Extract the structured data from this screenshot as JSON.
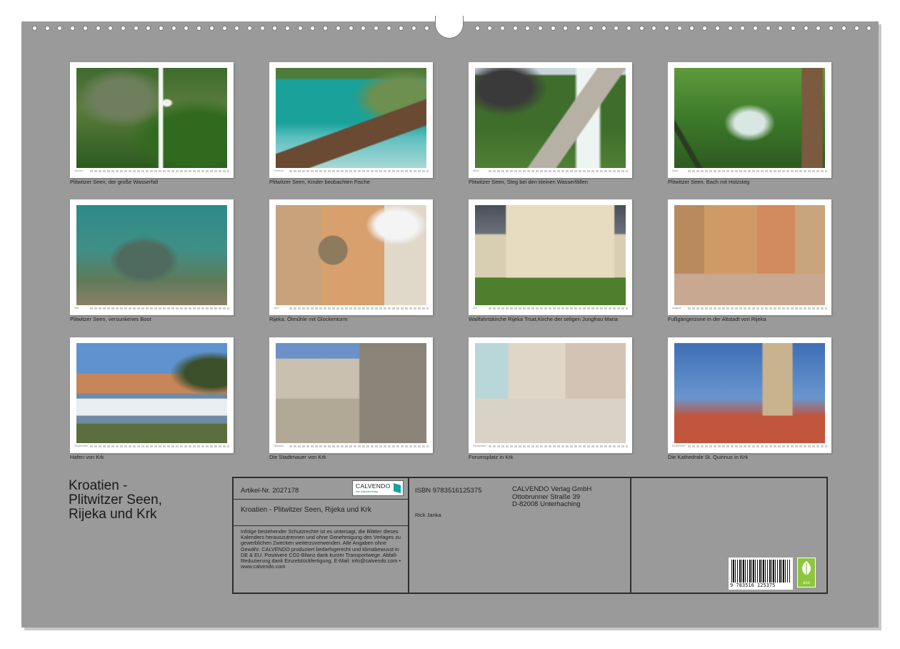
{
  "calendar_title": "Kroatien -\nPlitwitzer Seen,\nRijeka und Krk",
  "months": [
    {
      "name": "Januar",
      "caption": "Plitwitzer Seen, der große Wasserfall"
    },
    {
      "name": "Februar",
      "caption": "Plitwitzer Seen, Kinder beobachten Fische"
    },
    {
      "name": "März",
      "caption": "Plitwitzer Seen, Steg bei den kleinen Wasserfällen"
    },
    {
      "name": "April",
      "caption": "Plitwitzer Seen, Bach mit Holzsteg"
    },
    {
      "name": "Mai",
      "caption": "Plitwitzer Seen, versunkenes Boot"
    },
    {
      "name": "Juni",
      "caption": "Rijeka, Ölmühle mit Glockenturm"
    },
    {
      "name": "Juli",
      "caption": "Wallfahrtskirche Rijeka Trsat,Kirche der seligen Jungfrau Maria"
    },
    {
      "name": "August",
      "caption": "Fußgängerzone in der Altstadt von Rijeka"
    },
    {
      "name": "September",
      "caption": "Hafen von Krk"
    },
    {
      "name": "Oktober",
      "caption": "Die Stadtmauer von Krk"
    },
    {
      "name": "November",
      "caption": "Forumsplatz in Krk"
    },
    {
      "name": "Dezember",
      "caption": "Die Kathedrale St. Quirinus in Krk"
    }
  ],
  "info": {
    "article": "Artikel-Nr. 2027178",
    "logo_main": "CALVENDO",
    "logo_sub": "Ihre Kalenderverlag",
    "product_title": "Kroatien - Plitwitzer Seen, Rijeka und Krk",
    "legal": "Infolge bestehender Schutzrechte ist es untersagt, die Blätter dieses Kalenders herauszutrennen und ohne Genehmigung des Verlages zu gewerblichen Zwecken weiterzuverwenden. Alle Angaben ohne Gewähr. CALVENDO produziert bedarfsgerecht und klimabewusst in DE & EU. Positivere CO2-Bilanz dank kurzer Transportwege. Abfall-Reduzierung dank Einzelstückfertigung. E-Mail: info@calvendo.com • www.calvendo.com",
    "isbn": "ISBN 9783516125375",
    "author": "Rick Janka",
    "publisher": "CALVENDO Verlag GmbH\nOttobrunner Straße 39\nD-82008 Unterhaching",
    "barcode_number": "9 783516 125375",
    "eco_label": "eco"
  }
}
